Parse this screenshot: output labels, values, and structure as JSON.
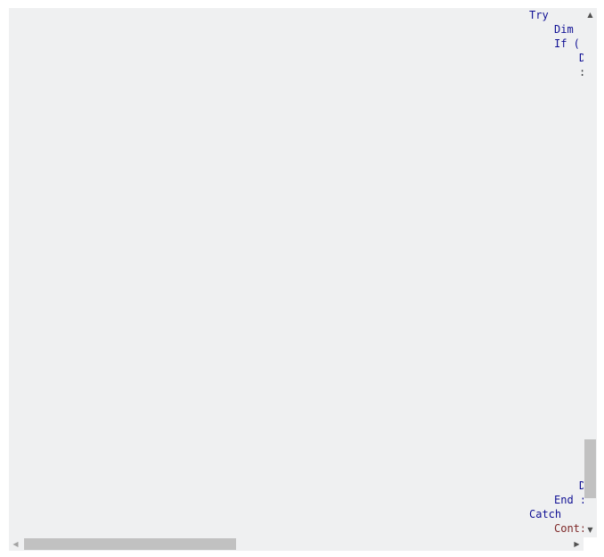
{
  "code_block": {
    "lines": [
      {
        "text": "Try"
      },
      {
        "text": "Dim "
      },
      {
        "text": "If ("
      },
      {
        "text": "D"
      },
      {
        "text": ":"
      },
      {
        "text": "D"
      },
      {
        "text": "End :"
      },
      {
        "text": "Catch"
      },
      {
        "text": "Cont:"
      }
    ]
  },
  "scrollbars": {
    "vertical": {
      "position_fraction": 0.96,
      "icons": {
        "up": "arrow-up-icon",
        "down": "arrow-down-icon"
      }
    },
    "horizontal": {
      "position_fraction": 0.0,
      "icons": {
        "left": "arrow-left-icon",
        "right": "arrow-right-icon"
      }
    }
  }
}
